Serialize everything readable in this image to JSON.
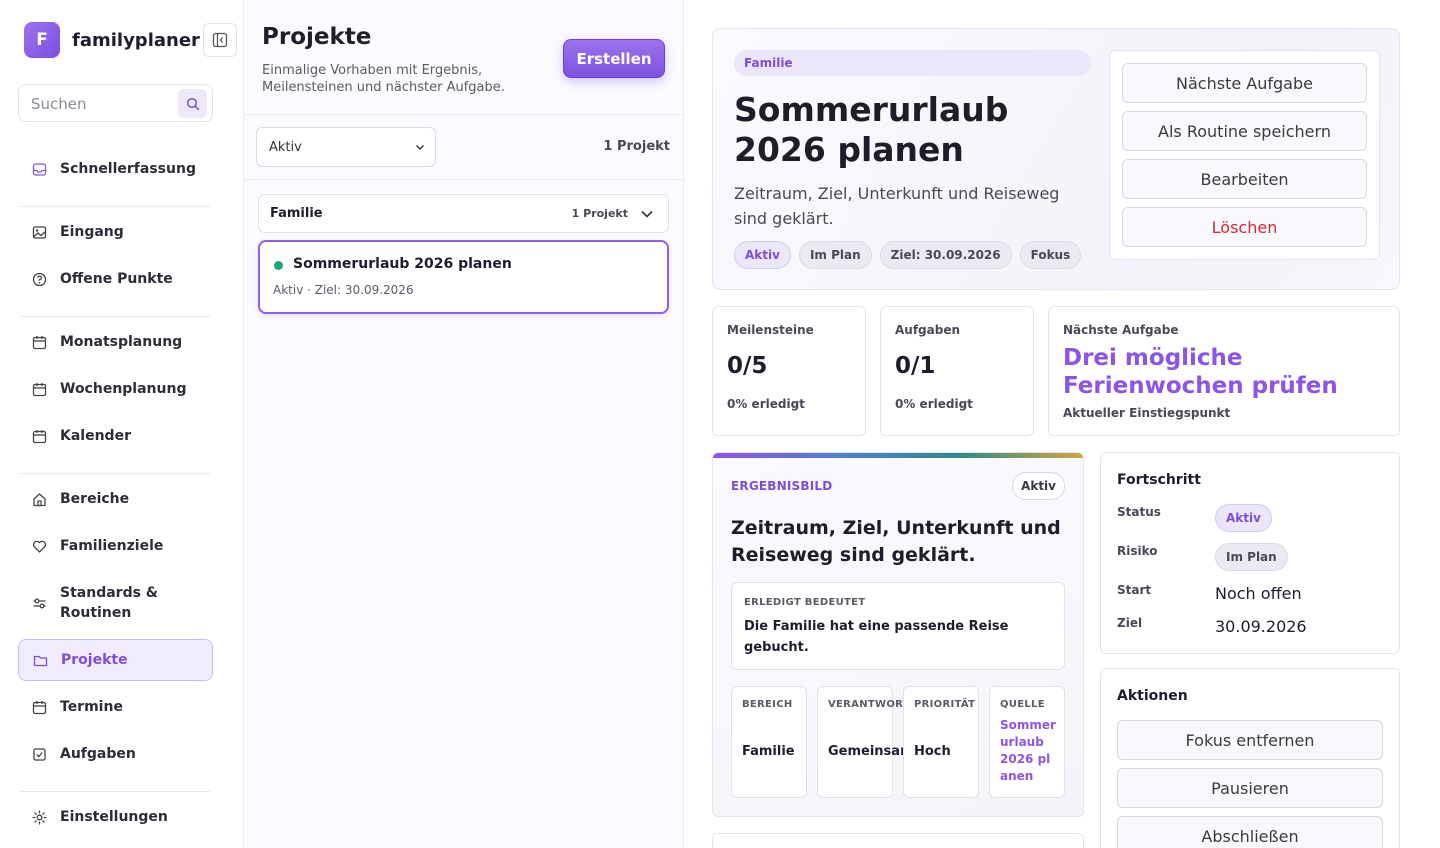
{
  "sidebar": {
    "brand_letter": "F",
    "brand_name": "familyplaner",
    "search_placeholder": "Suchen",
    "items": [
      {
        "label": "Schnellerfassung",
        "icon": "inbox-icon"
      },
      {
        "label": "Eingang",
        "icon": "image-icon"
      },
      {
        "label": "Offene Punkte",
        "icon": "help-circle-icon"
      },
      {
        "label": "Monatsplanung",
        "icon": "calendar-icon"
      },
      {
        "label": "Wochenplanung",
        "icon": "calendar-icon"
      },
      {
        "label": "Kalender",
        "icon": "calendar-icon"
      },
      {
        "label": "Bereiche",
        "icon": "home-icon"
      },
      {
        "label": "Familienziele",
        "icon": "heart-icon"
      },
      {
        "label": "Standards & Routinen",
        "icon": "sliders-icon"
      },
      {
        "label": "Projekte",
        "icon": "folder-icon",
        "active": true
      },
      {
        "label": "Termine",
        "icon": "calendar-icon"
      },
      {
        "label": "Aufgaben",
        "icon": "checkbox-icon"
      },
      {
        "label": "Einstellungen",
        "icon": "gear-icon"
      }
    ]
  },
  "list": {
    "title": "Projekte",
    "subtitle": "Einmalige Vorhaben mit Ergebnis, Meilensteinen und nächster Aufgabe.",
    "create_label": "Erstellen",
    "filter_value": "Aktiv",
    "project_count": "1 Projekt",
    "group": {
      "name": "Familie",
      "count": "1 Projekt"
    },
    "project": {
      "name": "Sommerurlaub 2026 planen",
      "meta": "Aktiv · Ziel: 30.09.2026",
      "status_color": "#1ba57a"
    }
  },
  "detail": {
    "category": "Familie",
    "title": "Sommerurlaub 2026 planen",
    "description": "Zeitraum, Ziel, Unterkunft und Reiseweg sind geklärt.",
    "chips": [
      "Aktiv",
      "Im Plan",
      "Ziel: 30.09.2026",
      "Fokus"
    ],
    "hero_actions": [
      "Nächste Aufgabe",
      "Als Routine speichern",
      "Bearbeiten",
      "Löschen"
    ],
    "stats": {
      "milestones": {
        "label": "Meilensteine",
        "value": "0/5",
        "sub": "0% erledigt"
      },
      "tasks": {
        "label": "Aufgaben",
        "value": "0/1",
        "sub": "0% erledigt"
      },
      "next": {
        "label": "Nächste Aufgabe",
        "value": "Drei mögliche Ferienwochen prüfen",
        "sub": "Aktueller Einstiegspunkt"
      }
    },
    "result": {
      "heading": "ERGEBNISBILD",
      "badge": "Aktiv",
      "title": "Zeitraum, Ziel, Unterkunft und Reiseweg sind geklärt.",
      "done_label": "ERLEDIGT BEDEUTET",
      "done_text": "Die Familie hat eine passende Reise gebucht.",
      "meta": [
        {
          "label": "BEREICH",
          "value": "Familie"
        },
        {
          "label": "VERANTWORTLICH",
          "value": "Gemeinsam"
        },
        {
          "label": "PRIORITÄT",
          "value": "Hoch"
        },
        {
          "label": "QUELLE",
          "value": "Sommerurlaub 2026 planen"
        }
      ]
    },
    "progress": {
      "title": "Fortschritt",
      "rows": [
        {
          "label": "Status",
          "value": "Aktiv"
        },
        {
          "label": "Risiko",
          "value": "Im Plan"
        },
        {
          "label": "Start",
          "value": "Noch offen"
        },
        {
          "label": "Ziel",
          "value": "30.09.2026"
        }
      ]
    },
    "actions": {
      "title": "Aktionen",
      "buttons": [
        "Fokus entfernen",
        "Pausieren",
        "Abschließen"
      ]
    }
  }
}
